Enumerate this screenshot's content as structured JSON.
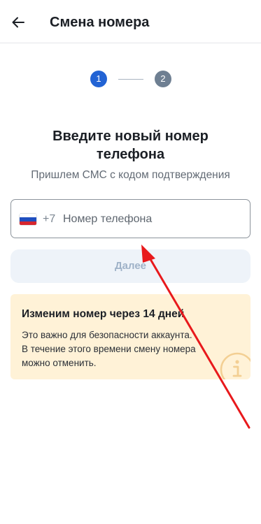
{
  "header": {
    "title": "Смена номера",
    "back_icon": "arrow-left-icon"
  },
  "stepper": {
    "steps": [
      "1",
      "2"
    ],
    "active_step": 1,
    "active_color": "#2263d4",
    "inactive_color": "#6e7f92"
  },
  "main": {
    "title": "Введите новый номер телефона",
    "subtitle": "Пришлем СМС с кодом подтверждения"
  },
  "phone_field": {
    "country_flag": "russia-flag-icon",
    "country_code": "+7",
    "placeholder": "Номер телефона",
    "value": ""
  },
  "next_button": {
    "label": "Далее",
    "enabled": false
  },
  "notice": {
    "title": "Изменим номер через 14 дней",
    "lines": [
      "Это важно для безопасности аккаунта.",
      "В течение этого времени смену номера",
      "можно отменить."
    ],
    "icon": "info-icon",
    "background": "#fff2d7"
  },
  "annotation": {
    "icon": "red-arrow-annotation",
    "color": "#e8191c"
  }
}
